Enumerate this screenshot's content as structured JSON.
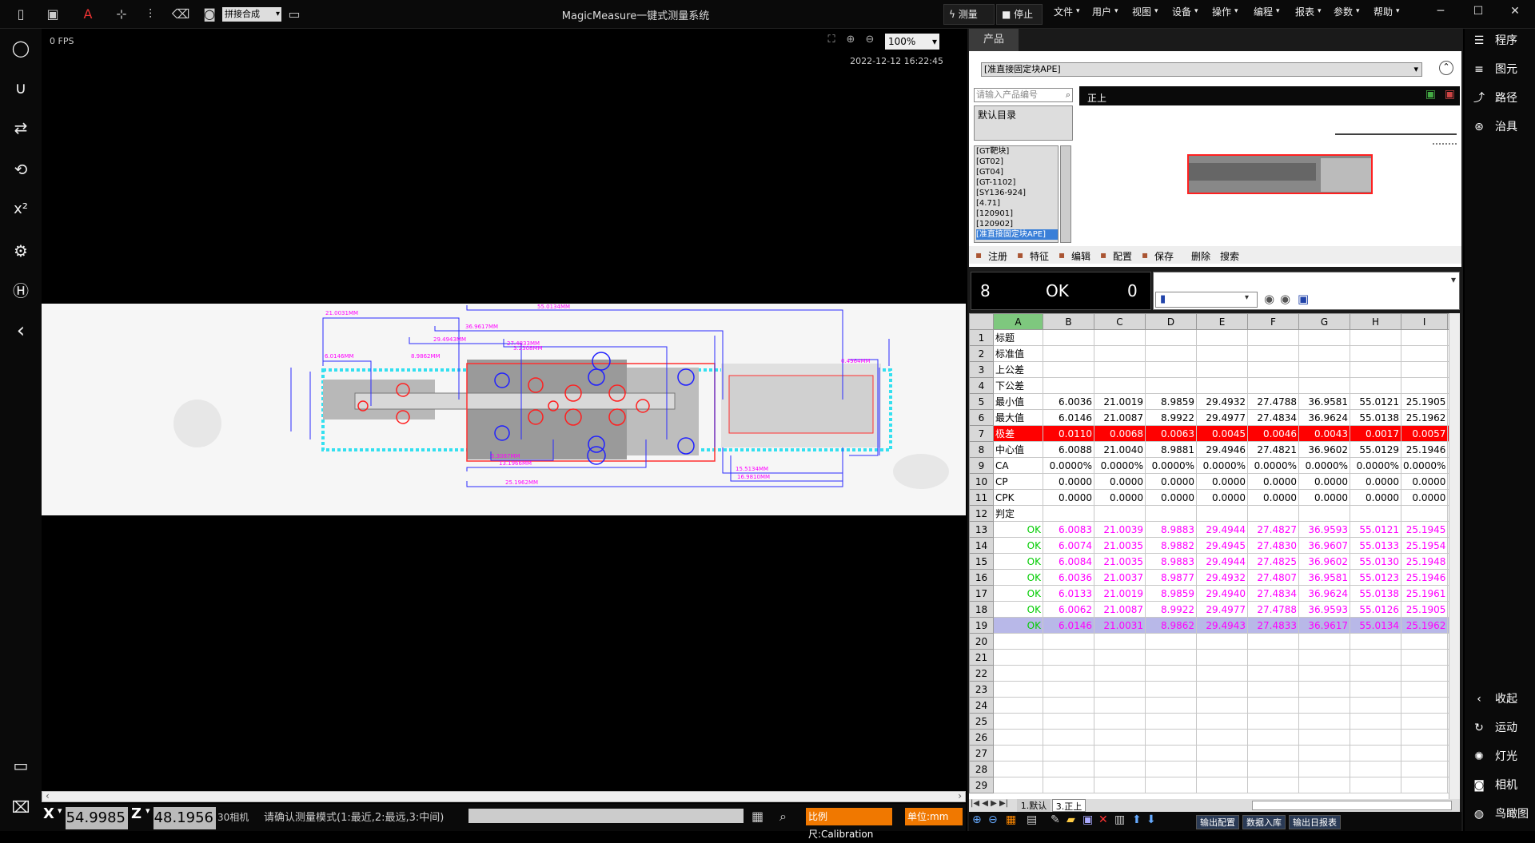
{
  "app": {
    "title": "MagicMeasure一键式测量系统"
  },
  "toolbar": {
    "mode_value": "拼接合成",
    "measure_label": "测量",
    "stop_label": "停止"
  },
  "menu": [
    "文件",
    "用户",
    "视图",
    "设备",
    "操作",
    "编程",
    "报表",
    "参数",
    "帮助"
  ],
  "viewer": {
    "fps": "0 FPS",
    "datetime": "2022-12-12 16:22:45",
    "zoom": "100%"
  },
  "status": {
    "x_label": "X",
    "x_value": "54.9985",
    "z_label": "Z",
    "z_value": "48.1956",
    "camera": "30相机",
    "message": "请确认测量模式(1:最近,2:最远,3:中间)",
    "scale": "比例尺:Calibration",
    "unit": "单位:mm"
  },
  "product": {
    "tab": "产品",
    "selected": "[准直接固定块APE]",
    "search_placeholder": "请输入产品编号",
    "tree_root": "默认目录",
    "items": [
      "[GT靶块]",
      "[GT02]",
      "[GT04]",
      "[GT-1102]",
      "[SY136-924]",
      "[4.71]",
      "[120901]",
      "[120902]",
      "[准直接固定块APE]"
    ],
    "preview_label": "正上",
    "tools": [
      "注册",
      "特征",
      "编辑",
      "配置",
      "保存",
      "删除",
      "搜索"
    ]
  },
  "result": {
    "count": "8",
    "status": "OK",
    "ng": "0"
  },
  "sheet": {
    "columns": [
      "A",
      "B",
      "C",
      "D",
      "E",
      "F",
      "G",
      "H",
      "I"
    ],
    "rows": [
      [
        "标题",
        "",
        "",
        "",
        "",
        "",
        "",
        "",
        ""
      ],
      [
        "标准值",
        "",
        "",
        "",
        "",
        "",
        "",
        "",
        ""
      ],
      [
        "上公差",
        "",
        "",
        "",
        "",
        "",
        "",
        "",
        ""
      ],
      [
        "下公差",
        "",
        "",
        "",
        "",
        "",
        "",
        "",
        ""
      ],
      [
        "最小值",
        "6.0036",
        "21.0019",
        "8.9859",
        "29.4932",
        "27.4788",
        "36.9581",
        "55.0121",
        "25.1905"
      ],
      [
        "最大值",
        "6.0146",
        "21.0087",
        "8.9922",
        "29.4977",
        "27.4834",
        "36.9624",
        "55.0138",
        "25.1962"
      ],
      [
        "极差",
        "0.0110",
        "0.0068",
        "0.0063",
        "0.0045",
        "0.0046",
        "0.0043",
        "0.0017",
        "0.0057"
      ],
      [
        "中心值",
        "6.0088",
        "21.0040",
        "8.9881",
        "29.4946",
        "27.4821",
        "36.9602",
        "55.0129",
        "25.1946"
      ],
      [
        "CA",
        "0.0000%",
        "0.0000%",
        "0.0000%",
        "0.0000%",
        "0.0000%",
        "0.0000%",
        "0.0000%",
        "0.0000%"
      ],
      [
        "CP",
        "0.0000",
        "0.0000",
        "0.0000",
        "0.0000",
        "0.0000",
        "0.0000",
        "0.0000",
        "0.0000"
      ],
      [
        "CPK",
        "0.0000",
        "0.0000",
        "0.0000",
        "0.0000",
        "0.0000",
        "0.0000",
        "0.0000",
        "0.0000"
      ],
      [
        "判定",
        "",
        "",
        "",
        "",
        "",
        "",
        "",
        ""
      ],
      [
        "OK",
        "6.0083",
        "21.0039",
        "8.9883",
        "29.4944",
        "27.4827",
        "36.9593",
        "55.0121",
        "25.1945"
      ],
      [
        "OK",
        "6.0074",
        "21.0035",
        "8.9882",
        "29.4945",
        "27.4830",
        "36.9607",
        "55.0133",
        "25.1954"
      ],
      [
        "OK",
        "6.0084",
        "21.0035",
        "8.9883",
        "29.4944",
        "27.4825",
        "36.9602",
        "55.0130",
        "25.1948"
      ],
      [
        "OK",
        "6.0036",
        "21.0037",
        "8.9877",
        "29.4932",
        "27.4807",
        "36.9581",
        "55.0123",
        "25.1946"
      ],
      [
        "OK",
        "6.0133",
        "21.0019",
        "8.9859",
        "29.4940",
        "27.4834",
        "36.9624",
        "55.0138",
        "25.1961"
      ],
      [
        "OK",
        "6.0062",
        "21.0087",
        "8.9922",
        "29.4977",
        "27.4788",
        "36.9593",
        "55.0126",
        "25.1905"
      ],
      [
        "OK",
        "6.0146",
        "21.0031",
        "8.9862",
        "29.4943",
        "27.4833",
        "36.9617",
        "55.0134",
        "25.1962"
      ],
      [
        "",
        "",
        "",
        "",
        "",
        "",
        "",
        "",
        ""
      ],
      [
        "",
        "",
        "",
        "",
        "",
        "",
        "",
        "",
        ""
      ],
      [
        "",
        "",
        "",
        "",
        "",
        "",
        "",
        "",
        ""
      ],
      [
        "",
        "",
        "",
        "",
        "",
        "",
        "",
        "",
        ""
      ],
      [
        "",
        "",
        "",
        "",
        "",
        "",
        "",
        "",
        ""
      ],
      [
        "",
        "",
        "",
        "",
        "",
        "",
        "",
        "",
        ""
      ],
      [
        "",
        "",
        "",
        "",
        "",
        "",
        "",
        "",
        ""
      ],
      [
        "",
        "",
        "",
        "",
        "",
        "",
        "",
        "",
        ""
      ],
      [
        "",
        "",
        "",
        "",
        "",
        "",
        "",
        "",
        ""
      ],
      [
        "",
        "",
        "",
        "",
        "",
        "",
        "",
        "",
        ""
      ]
    ],
    "sheet_tabs": [
      "1.默认",
      "3.正上"
    ]
  },
  "bottom_buttons": [
    "输出配置",
    "数据入库",
    "输出日报表"
  ],
  "rightbar": {
    "top": [
      {
        "label": "程序",
        "icon": "program-icon"
      },
      {
        "label": "图元",
        "icon": "database-icon"
      },
      {
        "label": "路径",
        "icon": "path-icon"
      },
      {
        "label": "治具",
        "icon": "fixture-icon"
      }
    ],
    "bottom": [
      {
        "label": "收起",
        "icon": "chevron-left-icon"
      },
      {
        "label": "运动",
        "icon": "motion-icon"
      },
      {
        "label": "灯光",
        "icon": "light-icon"
      },
      {
        "label": "相机",
        "icon": "camera-icon"
      },
      {
        "label": "鸟瞰图",
        "icon": "globe-icon"
      }
    ]
  },
  "drawing": {
    "dim_labels": [
      "55.0134MM",
      "36.9617MM",
      "21.0031MM",
      "29.4943MM",
      "27.4833MM",
      "8.9862MM",
      "6.0146MM",
      "5.3087MM",
      "13.1966MM",
      "25.1962MM",
      "15.5134MM",
      "16.9810MM",
      "0.4964MM",
      "3.2308MM"
    ]
  },
  "colors": {
    "accent": "#f07800",
    "ok": "#00cc00",
    "measure": "#ff00ff",
    "range_bg": "#ff0000"
  }
}
